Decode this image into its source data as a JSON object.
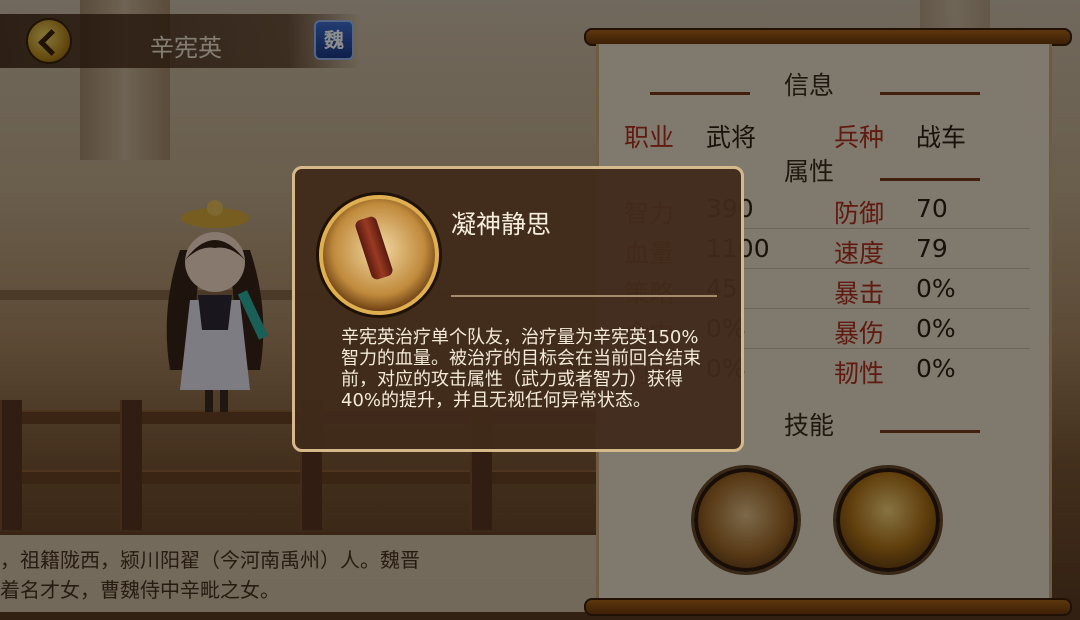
{
  "header": {
    "hero_name": "辛宪英",
    "faction_badge": "魏"
  },
  "bio": {
    "lines": [
      "，祖籍陇西，颍川阳翟（今河南禹州）人。魏晋",
      "着名才女，曹魏侍中辛毗之女。"
    ]
  },
  "info_panel": {
    "section_info_title": "信息",
    "profession_label": "职业",
    "profession_value": "武将",
    "troop_label": "兵种",
    "troop_value": "战车",
    "section_attr_title": "属性",
    "left_stats": [
      {
        "label": "智力",
        "value": "390"
      },
      {
        "label": "血量",
        "value": "1100"
      },
      {
        "label": "策略",
        "value": "45"
      },
      {
        "label": "命中",
        "value": "0%"
      },
      {
        "label": "闪避",
        "value": "0%"
      }
    ],
    "right_stats": [
      {
        "label": "防御",
        "value": "70"
      },
      {
        "label": "速度",
        "value": "79"
      },
      {
        "label": "暴击",
        "value": "0%"
      },
      {
        "label": "暴伤",
        "value": "0%"
      },
      {
        "label": "韧性",
        "value": "0%"
      }
    ],
    "section_skill_title": "技能"
  },
  "tooltip": {
    "skill_name": "凝神静思",
    "description": "辛宪英治疗单个队友，治疗量为辛宪英150%智力的血量。被治疗的目标会在当前回合结束前，对应的攻击属性（武力或者智力）获得40%的提升，并且无视任何异常状态。"
  },
  "icons": {
    "back": "back-arrow-icon",
    "skill_1": "scroll-skill-icon",
    "skill_2": "fire-scroll-skill-icon"
  }
}
